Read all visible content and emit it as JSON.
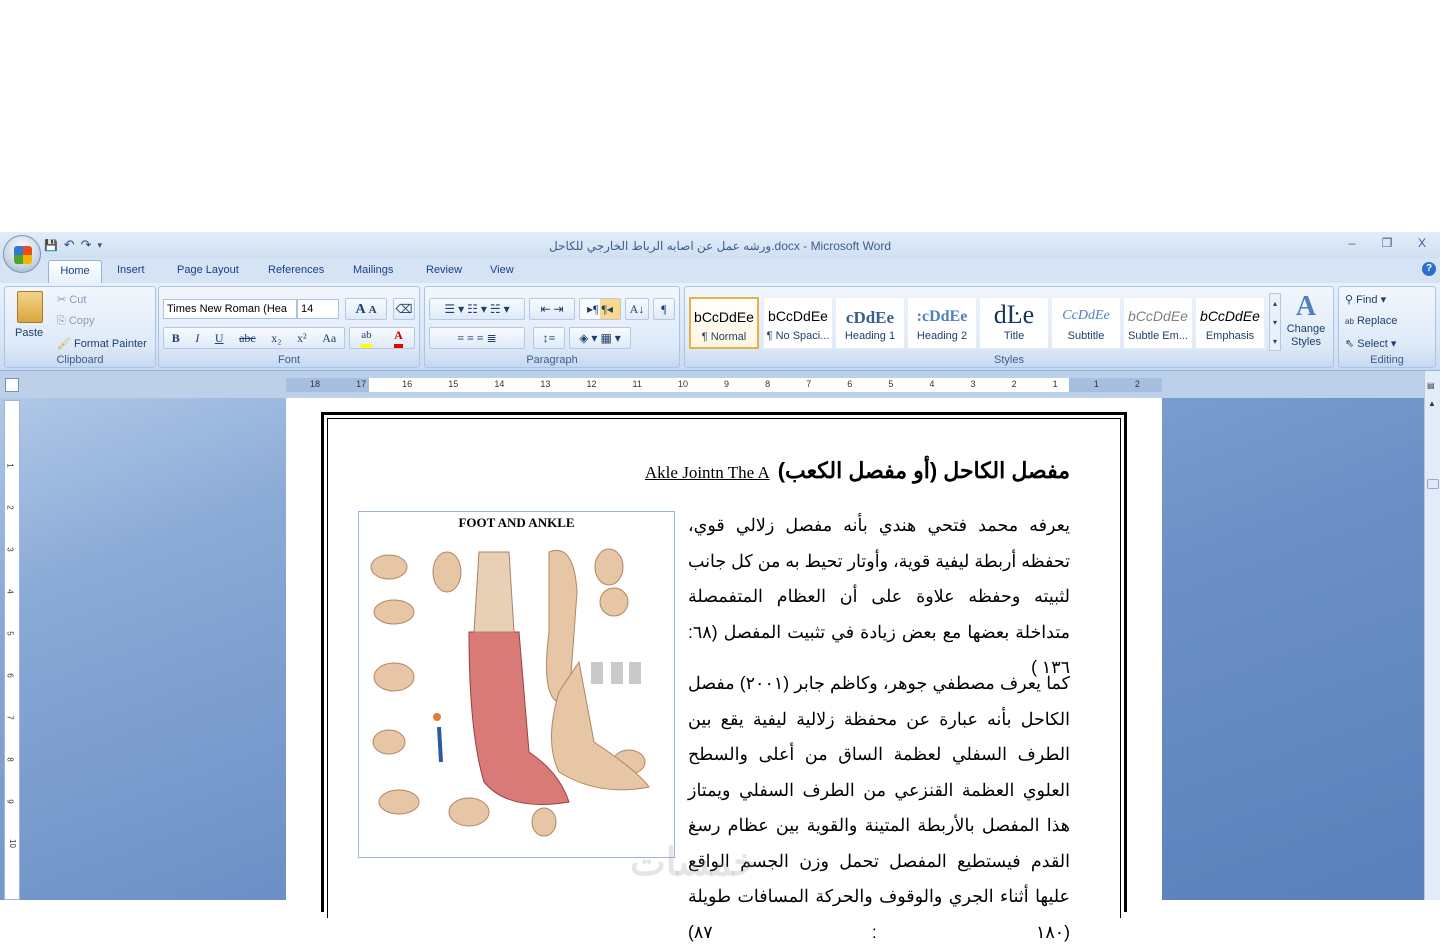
{
  "window": {
    "title": "ورشه عمل عن اصابه الرباط الخارجي للكاحل.docx - Microsoft Word",
    "minimize": "–",
    "restore": "❐",
    "close": "X"
  },
  "qat": {
    "save": "💾",
    "undo": "↶",
    "redo": "↷",
    "more": "▾"
  },
  "tabs": [
    "Home",
    "Insert",
    "Page Layout",
    "References",
    "Mailings",
    "Review",
    "View"
  ],
  "clipboard": {
    "label": "Clipboard",
    "paste": "Paste",
    "cut": "Cut",
    "copy": "Copy",
    "format_painter": "Format Painter"
  },
  "font": {
    "label": "Font",
    "name": "Times New Roman (Hea",
    "size": "14",
    "grow": "A",
    "shrink": "A",
    "bold": "B",
    "italic": "I",
    "underline": "U",
    "strike": "abc",
    "subscript": "x₂",
    "superscript": "x²",
    "case": "Aa",
    "highlight": "ab",
    "color": "A"
  },
  "paragraph": {
    "label": "Paragraph",
    "pilcrow": "¶"
  },
  "styles": {
    "label": "Styles",
    "items": [
      {
        "preview": "bCcDdEe",
        "name": "¶ Normal"
      },
      {
        "preview": "bCcDdEe",
        "name": "¶ No Spaci..."
      },
      {
        "preview": "cDdEe",
        "name": "Heading 1"
      },
      {
        "preview": ":cDdEe",
        "name": "Heading 2"
      },
      {
        "preview": "dĿe",
        "name": "Title"
      },
      {
        "preview": "CcDdEe",
        "name": "Subtitle"
      },
      {
        "preview": "bCcDdEe",
        "name": "Subtle Em..."
      },
      {
        "preview": "bCcDdEe",
        "name": "Emphasis"
      }
    ],
    "change_styles": "Change Styles"
  },
  "editing": {
    "label": "Editing",
    "find": "Find",
    "replace": "Replace",
    "select": "Select"
  },
  "ruler": {
    "numbers": [
      "18",
      "17",
      "16",
      "15",
      "14",
      "13",
      "12",
      "11",
      "10",
      "9",
      "8",
      "7",
      "6",
      "5",
      "4",
      "3",
      "2",
      "1",
      "1",
      "2"
    ],
    "vnumbers": [
      "1",
      "2",
      "3",
      "4",
      "5",
      "6",
      "7",
      "8",
      "9",
      "10"
    ]
  },
  "document": {
    "heading_ar": "مفصل الكاحل (أو مفصل الكعب)",
    "heading_en": "Akle Jointn The A",
    "figure_title": "FOOT AND ANKLE",
    "para1": "يعرفه محمد فتحي هندي بأنه مفصل زلالي قوي، تحفظه أربطة ليفية قوية، وأوتار تحيط به من كل جانب لثبيته وحفظه علاوة على أن العظام المتفمصلة متداخلة بعضها مع بعض زيادة في تثبيت المفصل (٦٨: ١٣٦ )",
    "para2": "كما يعرف مصطفي جوهر، وكاظم جابر (٢٠٠١) مفصل الكاحل بأنه عبارة عن محفظة زلالية ليفية يقع بين الطرف السفلي لعظمة الساق من أعلى والسطح العلوي العظمة القنزعي من الطرف السفلي ويمتاز هذا المفصل بالأربطة المتينة والقوية بين عظام رسغ القدم فيستطيع المفصل تحمل وزن الجسم الواقع عليها أثناء الجري والوقوف والحركة المسافات طويلة (١٨٠ : ٨٧)",
    "watermark": "خمسات"
  }
}
